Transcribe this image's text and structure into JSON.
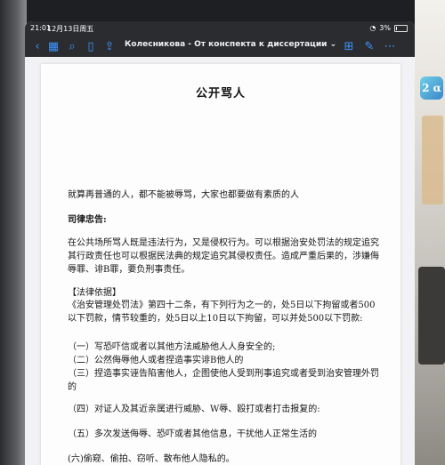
{
  "status_bar": {
    "time": "21:01",
    "date": "12月13日周五",
    "signal": "◔",
    "battery": "3%"
  },
  "toolbar": {
    "title": "Колесникова - От конспекта к диссертации",
    "title_chevron": "⌄",
    "icons": [
      "chevron-left-icon",
      "grid-icon",
      "search-icon",
      "bookmark-icon",
      "share-icon",
      "add-page-icon",
      "annotate-icon",
      "more-icon"
    ]
  },
  "document": {
    "title": "公开骂人",
    "intro": "就算再普通的人，都不能被辱骂，大家也都要做有素质的人",
    "warning_heading": "司律忠告:",
    "warning_text": "在公共场所骂人既是违法行为，又是侵权行为。可以根据治安处罚法的规定追究其行政责任也可以根据民法典的规定追究其侵权责任。造成严重后果的，涉嫌侮辱罪、诽B罪，要负刑事责任。",
    "legal_basis": "【法律依据】",
    "legal_text": "《治安管理处罚法》第四十二条，有下列行为之一的，处5日以下拘留或者500以下罚款，情节较重的，处5日以上10日以下拘留，可以并处500以下罚款:",
    "item1": "（一）写恐吓信或者以其他方法威胁他人人身安全的;",
    "item2": "（二）公然侮辱他人或者捏造事实诽B他人的",
    "item3": "（三）捏造事实诬告陷害他人，企图使他人受到刑事追究或者受到治安管理外罚的",
    "item4": "（四）对证人及其近亲属进行威胁、W辱、殴打或者打击报复的:",
    "item5": "（五）多次发送侮辱、恐吓或者其他信息，干扰他人正常生活的",
    "item6": "(六)偷窥、偷拍、窃听、散布他人隐私的。"
  },
  "background": {
    "icon_text": "2\nα"
  }
}
